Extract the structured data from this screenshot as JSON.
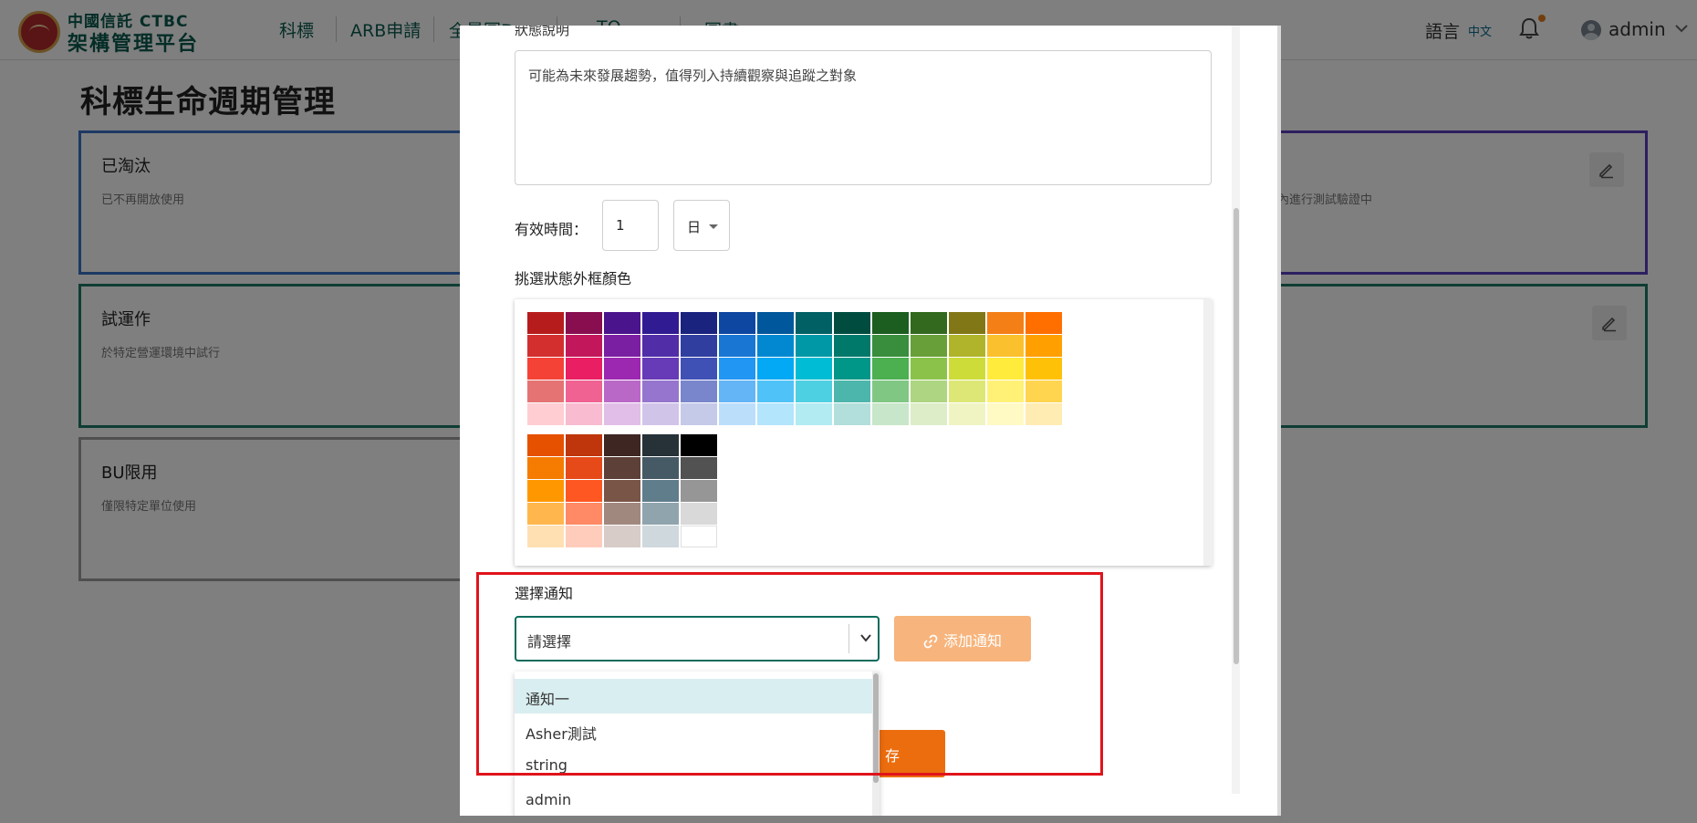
{
  "header": {
    "logo_line1": "中國信託 CTBC",
    "logo_line2": "架構管理平台",
    "nav": [
      "科標",
      "ARB申請",
      "全景圖D",
      "TO",
      "圖書"
    ],
    "language_label": "語言",
    "language_value": "中文",
    "user_name": "admin"
  },
  "page": {
    "title": "科標生命週期管理",
    "cards": [
      {
        "title": "已淘汰",
        "description": "已不再開放使用",
        "border_color": "#3b73c8"
      },
      {
        "title": "試運作",
        "description": "於特定營運環境中試行",
        "border_color": "#1f7b66"
      },
      {
        "title": "BU限用",
        "description": "僅限特定單位使用",
        "border_color": "#9e9e9e"
      }
    ],
    "right_card_desc": "內進行測試驗證中",
    "right_card_borders": [
      "#5a3fc0",
      "#1f7b66"
    ]
  },
  "modal": {
    "status_desc_label": "狀態說明",
    "status_desc_value": "可能為未來發展趨勢，值得列入持續觀察與追蹤之對象",
    "valid_time_label": "有效時間：",
    "valid_time_value": "1",
    "valid_time_unit": "日",
    "border_color_label": "挑選狀態外框顏色",
    "selected_color": "#fdd835",
    "palette_row1": [
      [
        "#b71c1c",
        "#d32f2f",
        "#f44336",
        "#e57373",
        "#ffcdd2"
      ],
      [
        "#880e4f",
        "#c2185b",
        "#e91e63",
        "#f06292",
        "#f8bbd0"
      ],
      [
        "#4a148c",
        "#7b1fa2",
        "#9c27b0",
        "#ba68c8",
        "#e1bee7"
      ],
      [
        "#311b92",
        "#512da8",
        "#673ab7",
        "#9575cd",
        "#d1c4e9"
      ],
      [
        "#1a237e",
        "#303f9f",
        "#3f51b5",
        "#7986cb",
        "#c5cae9"
      ],
      [
        "#0d47a1",
        "#1976d2",
        "#2196f3",
        "#64b5f6",
        "#bbdefb"
      ],
      [
        "#01579b",
        "#0288d1",
        "#03a9f4",
        "#4fc3f7",
        "#b3e5fc"
      ],
      [
        "#006064",
        "#0097a7",
        "#00bcd4",
        "#4dd0e1",
        "#b2ebf2"
      ],
      [
        "#004d40",
        "#00796b",
        "#009688",
        "#4db6ac",
        "#b2dfdb"
      ],
      [
        "#1b5e20",
        "#388e3c",
        "#4caf50",
        "#81c784",
        "#c8e6c9"
      ],
      [
        "#33691e",
        "#689f38",
        "#8bc34a",
        "#aed581",
        "#dcedc8"
      ],
      [
        "#827717",
        "#afb42b",
        "#cddc39",
        "#dce775",
        "#f0f4c3"
      ],
      [
        "#f57f17",
        "#fbc02d",
        "#ffeb3b",
        "#fff176",
        "#fff9c4"
      ],
      [
        "#ff6f00",
        "#ffa000",
        "#ffc107",
        "#ffd54f",
        "#ffecb3"
      ]
    ],
    "palette_row2": [
      [
        "#e65100",
        "#f57c00",
        "#ff9800",
        "#ffb74d",
        "#ffe0b2"
      ],
      [
        "#bf360c",
        "#e64a19",
        "#ff5722",
        "#ff8a65",
        "#ffccbc"
      ],
      [
        "#3e2723",
        "#5d4037",
        "#795548",
        "#a1887f",
        "#d7ccc8"
      ],
      [
        "#263238",
        "#455a64",
        "#607d8b",
        "#90a4ae",
        "#cfd8dc"
      ],
      [
        "#000000",
        "#525252",
        "#969696",
        "#d9d9d9",
        "#ffffff"
      ]
    ],
    "notify_label": "選擇通知",
    "notify_placeholder": "請選擇",
    "add_notify_label": "添加通知",
    "save_label": "存",
    "notify_options": [
      "通知一",
      "Asher測試",
      "string",
      "admin"
    ]
  }
}
